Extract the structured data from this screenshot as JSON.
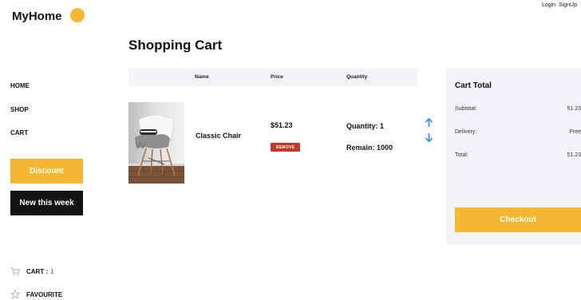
{
  "brand": {
    "name": "MyHome",
    "accent": "#f5b731"
  },
  "topbar": {
    "login": "Login",
    "signup": "SignUp"
  },
  "sidebar": {
    "items": [
      {
        "label": "HOME"
      },
      {
        "label": "SHOP"
      },
      {
        "label": "CART"
      }
    ],
    "discount_label": "Discount",
    "new_label": "New this week"
  },
  "footer": {
    "cart_label": "CART :",
    "cart_count": "1",
    "favourite_label": "FAVOURITE"
  },
  "page": {
    "title": "Shopping Cart"
  },
  "table": {
    "headers": {
      "name": "Name",
      "price": "Price",
      "quantity": "Quantity"
    },
    "row": {
      "name": "Classic Chair",
      "price": "$51.23",
      "remove_label": "REMOVE",
      "quantity": "Quantity: 1",
      "remain": "Remain: 1000",
      "remove_color": "#c0392b",
      "arrow_color": "#3a9ad9"
    }
  },
  "summary": {
    "title": "Cart Total",
    "subtotal_label": "Subtotal:",
    "subtotal_value": "51.23",
    "delivery_label": "Delivery:",
    "delivery_value": "Free",
    "total_label": "Total:",
    "total_value": "51.23",
    "checkout_label": "Checkout"
  }
}
